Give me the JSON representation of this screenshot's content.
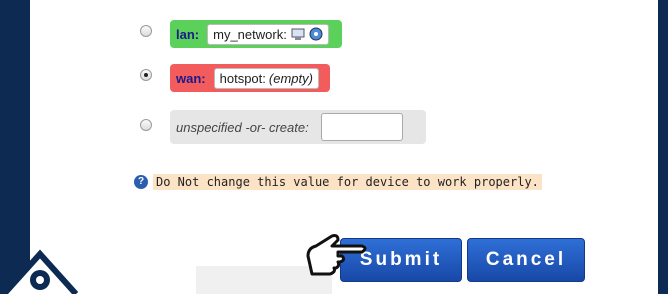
{
  "zones": [
    {
      "label": "lan:",
      "network": "my_network:",
      "suffix": "",
      "checked": false,
      "color": "#5bd05b"
    },
    {
      "label": "wan:",
      "network": "hotspot:",
      "suffix": "(empty)",
      "checked": true,
      "color": "#f25c5c"
    }
  ],
  "unspecified": {
    "label": "unspecified -or- create:",
    "value": ""
  },
  "note": {
    "text": "Do Not change this value for device to work properly.",
    "icon": "help-icon"
  },
  "buttons": {
    "submit": "Submit",
    "cancel": "Cancel"
  },
  "colors": {
    "lan": "#5bd05b",
    "wan": "#f25c5c",
    "note_bg": "#fde3c6",
    "button": "#1f57bd",
    "background": "#0d2a52"
  }
}
